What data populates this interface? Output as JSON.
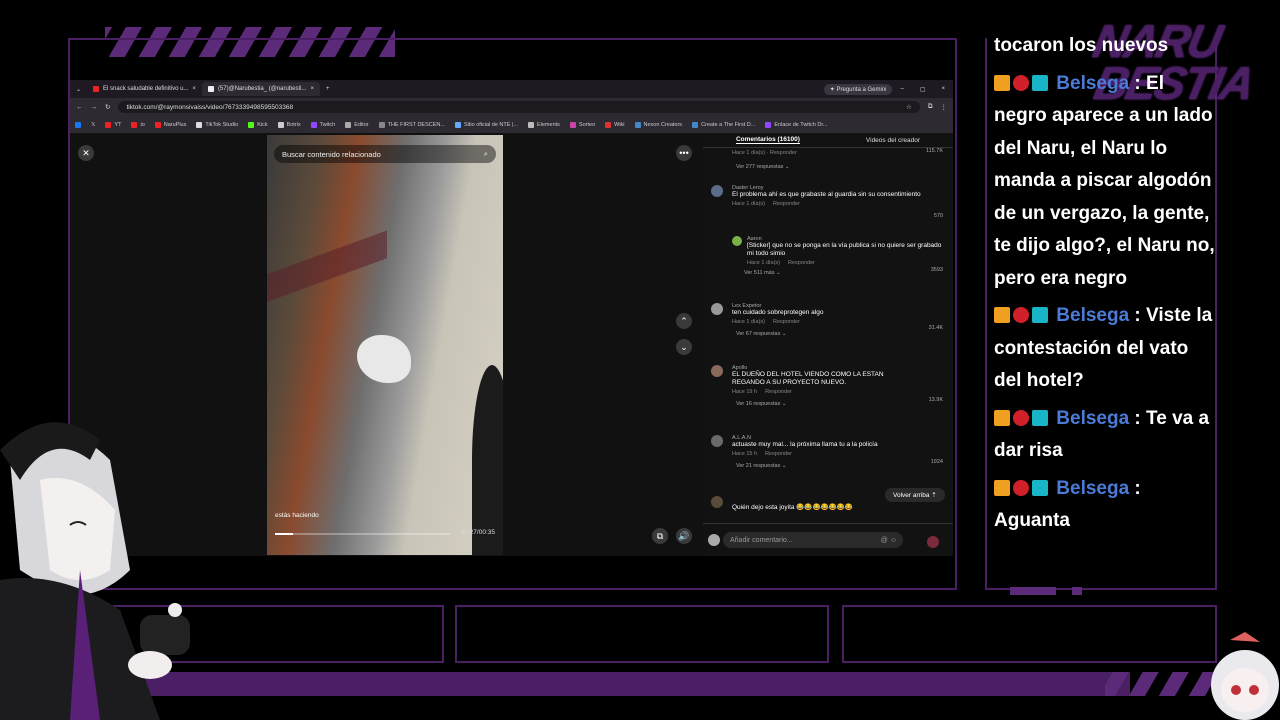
{
  "browser": {
    "tabs": [
      {
        "label": "El snack saludable definitivo u..."
      },
      {
        "label": "(57)@Narubestia_ (@narubesti..."
      }
    ],
    "gemini": "Pregunta a Gemini",
    "url": "tiktok.com/@raymonsivaiss/video/7673339498595503368",
    "bookmarks": [
      "YT",
      "io",
      "NaruPlus",
      "TikTok Studio",
      "Kick",
      "Botrix",
      "Twitch",
      "Editor",
      "THE FIRST DESCEN...",
      "Sitio oficial de NTE |...",
      "Elements",
      "Sorteo",
      "Wiki",
      "Nexon Creators",
      "Create a The First D...",
      "Enlace de Twitch Dr..."
    ]
  },
  "video": {
    "search_placeholder": "Buscar contenido relacionado",
    "caption": "estás haciendo",
    "time": "00:27/00:35",
    "progress": 0.1
  },
  "comments_panel": {
    "tab_comments": "Comentarios (16100)",
    "tab_creator": "Videos del creador",
    "top_partial": {
      "meta": "Hace 1 día(s) · Responder",
      "likes": "115.7K",
      "more": "Ver 277 respuestas"
    },
    "items": [
      {
        "name": "Daster Leroy",
        "text": "El problema ahí es que grabaste al guardia sin su consentimiento",
        "time": "Hace 1 día(s)",
        "reply": "Responder",
        "likes": "570"
      },
      {
        "name": "Aaron",
        "text": "[Sticker] que no se ponga en la vía publica si no quiere ser grabado mi todo simio",
        "time": "Hace 1 día(s)",
        "reply": "Responder",
        "likes": "3593",
        "more": "Ver 511 más"
      },
      {
        "name": "Lex Expetor",
        "text": "ten cuidado sobreprotegen algo",
        "time": "Hace 1 día(s)",
        "reply": "Responder",
        "likes": "31.4K",
        "more": "Ver 67 respuestas"
      },
      {
        "name": "Apollo",
        "text": "EL DUEÑO DEL HOTEL VIENDO COMO LA ESTAN REGANDO A SU PROYECTO NUEVO.",
        "time": "Hace 19 h",
        "reply": "Responder",
        "likes": "13.9K",
        "more": "Ver 16 respuestas"
      },
      {
        "name": "A.L.A.N",
        "text": "actuaste muy mal... la próxima llama tu a la policía",
        "time": "Hace 15 h",
        "reply": "Responder",
        "likes": "1924",
        "more": "Ver 21 respuestas"
      },
      {
        "name": "",
        "text": "Quién dejo esta joyita 😂😂😂😂😂😂😂",
        "time": "",
        "reply": "",
        "likes": ""
      }
    ],
    "back_to_top": "Volver arriba",
    "add_placeholder": "Añadir comentario..."
  },
  "chat": {
    "partial_top": "tocaron los nuevos",
    "messages": [
      {
        "user": "Belsega",
        "text": " : El negro aparece a un lado del Naru, el Naru lo manda a piscar algodón de un vergazo, la gente, te dijo algo?, el Naru no, pero era negro"
      },
      {
        "user": "Belsega",
        "text": " : Viste la contestación del vato del hotel?"
      },
      {
        "user": "Belsega",
        "text": " : Te va a dar risa"
      },
      {
        "user": "Belsega",
        "text": " : Aguanta"
      }
    ]
  },
  "logo": {
    "line1": "NARU",
    "line2": "BESTIA"
  },
  "colors": {
    "frame": "#4a1f63",
    "username": "#4a7bd8",
    "accent": "#5b2a78"
  }
}
